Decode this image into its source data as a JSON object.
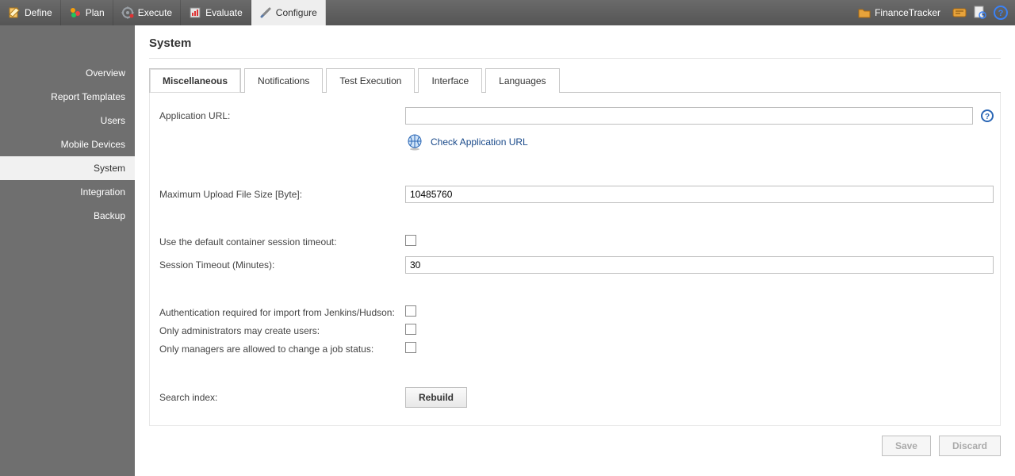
{
  "topnav": {
    "items": [
      {
        "label": "Define"
      },
      {
        "label": "Plan"
      },
      {
        "label": "Execute"
      },
      {
        "label": "Evaluate"
      },
      {
        "label": "Configure"
      }
    ],
    "project_label": "FinanceTracker"
  },
  "sidebar": {
    "items": [
      {
        "label": "Overview"
      },
      {
        "label": "Report Templates"
      },
      {
        "label": "Users"
      },
      {
        "label": "Mobile Devices"
      },
      {
        "label": "System"
      },
      {
        "label": "Integration"
      },
      {
        "label": "Backup"
      }
    ]
  },
  "page": {
    "title": "System",
    "tabs": [
      {
        "label": "Miscellaneous"
      },
      {
        "label": "Notifications"
      },
      {
        "label": "Test Execution"
      },
      {
        "label": "Interface"
      },
      {
        "label": "Languages"
      }
    ],
    "fields": {
      "application_url_label": "Application URL:",
      "application_url_value": "",
      "check_app_url_label": "Check Application URL",
      "max_upload_label": "Maximum Upload File Size [Byte]:",
      "max_upload_value": "10485760",
      "use_default_timeout_label": "Use the default container session timeout:",
      "session_timeout_label": "Session Timeout (Minutes):",
      "session_timeout_value": "30",
      "auth_jenkins_label": "Authentication required for import from Jenkins/Hudson:",
      "only_admin_label": "Only administrators may create users:",
      "only_manager_label": "Only managers are allowed to change a job status:",
      "search_index_label": "Search index:",
      "rebuild_label": "Rebuild"
    },
    "actions": {
      "save": "Save",
      "discard": "Discard"
    }
  }
}
